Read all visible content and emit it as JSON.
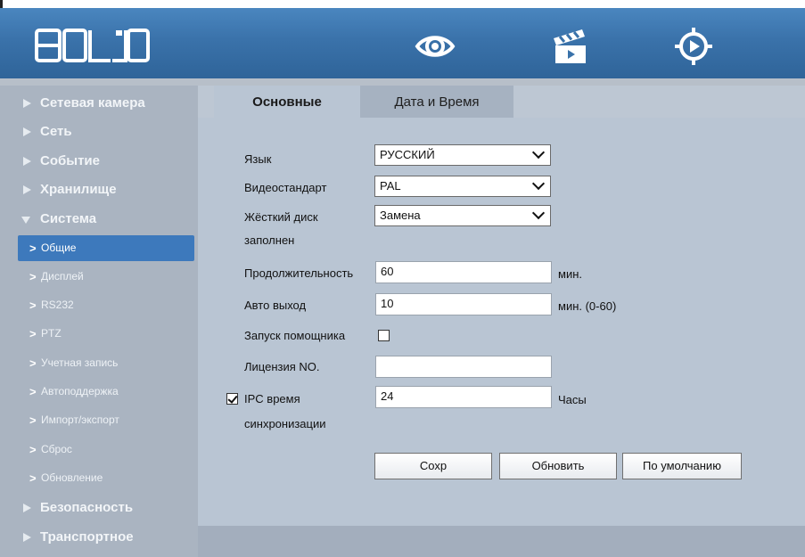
{
  "header": {
    "logo_text": "BOLID",
    "nav_icons": [
      "eye-icon",
      "clapperboard-icon",
      "crosshair-icon"
    ],
    "brand_color": "#3a72aa"
  },
  "sidebar": {
    "items": [
      {
        "label": "Сетевая камера",
        "expanded": false
      },
      {
        "label": "Сеть",
        "expanded": false
      },
      {
        "label": "Событие",
        "expanded": false
      },
      {
        "label": "Хранилище",
        "expanded": false
      },
      {
        "label": "Система",
        "expanded": true
      },
      {
        "label": "Безопасность",
        "expanded": false
      },
      {
        "label": "Транспортное",
        "expanded": false
      }
    ],
    "subitems": [
      {
        "label": "Общие",
        "active": true
      },
      {
        "label": "Дисплей",
        "active": false
      },
      {
        "label": "RS232",
        "active": false
      },
      {
        "label": "PTZ",
        "active": false
      },
      {
        "label": "Учетная запись",
        "active": false
      },
      {
        "label": "Автоподдержка",
        "active": false
      },
      {
        "label": "Импорт/экспорт",
        "active": false
      },
      {
        "label": "Сброс",
        "active": false
      },
      {
        "label": "Обновление",
        "active": false
      }
    ]
  },
  "tabs": [
    {
      "label": "Основные",
      "active": true
    },
    {
      "label": "Дата и Время",
      "active": false
    }
  ],
  "form": {
    "language": {
      "label": "Язык",
      "value": "РУССКИЙ"
    },
    "video_standard": {
      "label": "Видеостандарт",
      "value": "PAL"
    },
    "hdd_full": {
      "label_line1": "Жёсткий диск",
      "label_line2": "заполнен",
      "value": "Замена"
    },
    "duration": {
      "label": "Продолжительность",
      "value": "60",
      "unit": "мин."
    },
    "auto_logout": {
      "label": "Авто выход",
      "value": "10",
      "unit": "мин. (0-60)"
    },
    "startup_wizard": {
      "label": "Запуск помощника",
      "checked": false
    },
    "license_no": {
      "label": "Лицензия NO.",
      "value": ""
    },
    "ipc_sync": {
      "label_line1": "IPC время",
      "label_line2": "синхронизации",
      "checked": true,
      "value": "24",
      "unit": "Часы"
    }
  },
  "buttons": {
    "save": "Сохр",
    "refresh": "Обновить",
    "default": "По умолчанию"
  }
}
